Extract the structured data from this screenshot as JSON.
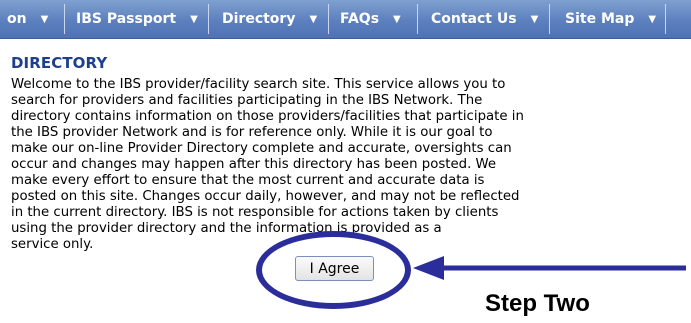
{
  "nav": {
    "items": [
      {
        "label": "on"
      },
      {
        "label": "IBS Passport"
      },
      {
        "label": "Directory"
      },
      {
        "label": "FAQs"
      },
      {
        "label": "Contact Us"
      },
      {
        "label": "Site Map"
      },
      {
        "label": ""
      }
    ],
    "arrow_glyph": "▼"
  },
  "page": {
    "heading": "DIRECTORY",
    "lines": [
      "Welcome to the IBS provider/facility search site. This service allows you to",
      "search for providers and facilities participating in the IBS Network. The",
      "directory contains information on those providers/facilities that participate in",
      "the IBS provider Network and is for reference only. While it is our goal to",
      "make our on-line Provider Directory complete and accurate, oversights can",
      "occur and changes may happen after this directory has been posted. We",
      "make every effort to ensure that the most current and accurate data is",
      "posted on this site. Changes occur daily, however, and may not be reflected",
      "in the current directory. IBS is not responsible for actions taken by clients",
      "using the provider directory and the information is provided as a",
      "service only."
    ],
    "agree_button": "I Agree"
  },
  "annotation": {
    "step_label": "Step Two",
    "color": "#2b2e9a"
  }
}
